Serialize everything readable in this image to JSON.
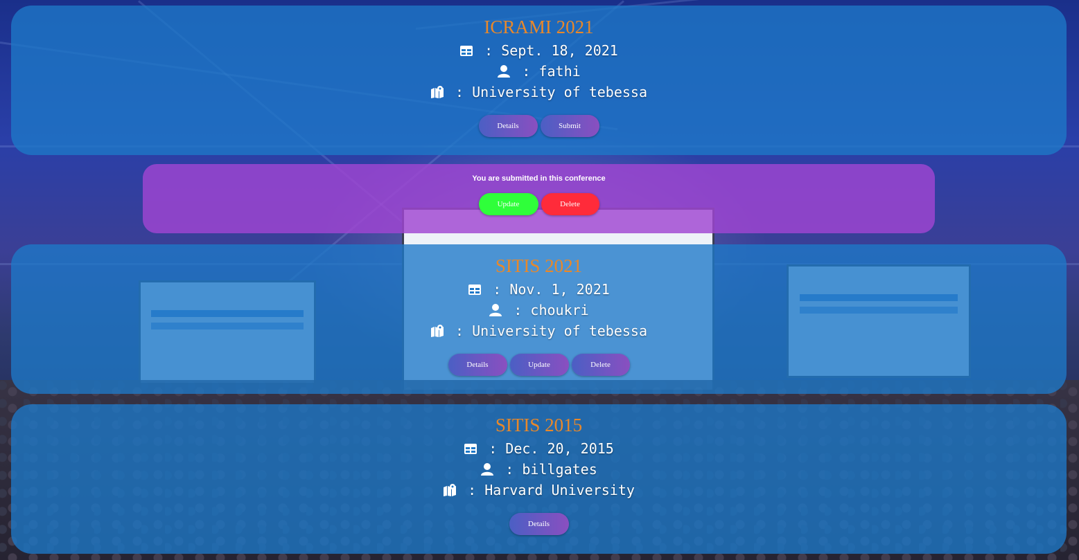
{
  "conferences": [
    {
      "title": "ICRAMI 2021",
      "date": "Sept. 18, 2021",
      "user": "fathi",
      "location": "University of tebessa",
      "buttons": [
        "Details",
        "Submit"
      ]
    },
    {
      "title": "SITIS 2021",
      "date": "Nov. 1, 2021",
      "user": "choukri",
      "location": "University of tebessa",
      "buttons": [
        "Details",
        "Update",
        "Delete"
      ]
    },
    {
      "title": "SITIS 2015",
      "date": "Dec. 20, 2015",
      "user": "billgates",
      "location": "Harvard University",
      "buttons": [
        "Details"
      ]
    }
  ],
  "submission_notice": {
    "message": "You are submitted in this conference",
    "update_label": "Update",
    "delete_label": "Delete"
  },
  "separator": " : ",
  "icons": {
    "date": "calendar-table-icon",
    "user": "user-icon",
    "location": "map-location-icon"
  },
  "colors": {
    "title": "#e8882a",
    "card": "#1e78c8",
    "notice": "#a046d2",
    "update_green": "#2fff3a",
    "delete_red": "#ff2b3a"
  }
}
